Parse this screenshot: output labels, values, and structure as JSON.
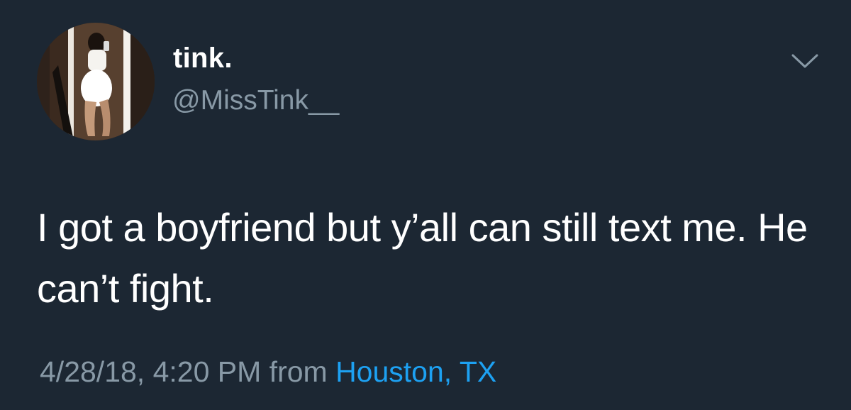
{
  "tweet": {
    "display_name": "tink.",
    "handle": "@MissTink__",
    "text": "I got a boyfriend but y’all can still text me. He can’t fight.",
    "timestamp": "4/28/18, 4:20 PM",
    "from_word": "from",
    "location": "Houston, TX"
  },
  "icons": {
    "avatar": "profile-photo",
    "menu": "chevron-down-icon"
  },
  "colors": {
    "background": "#1c2733",
    "text": "#ffffff",
    "secondary_text": "#8899a6",
    "link": "#1da1f2"
  }
}
